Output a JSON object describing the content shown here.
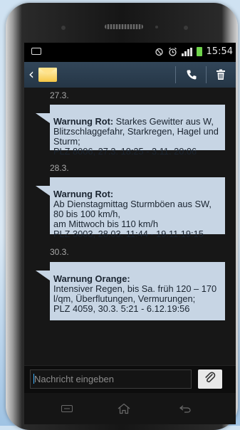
{
  "status_bar": {
    "time": "15:54",
    "icons": [
      "image-notification-icon",
      "nfc-icon",
      "alarm-icon",
      "signal-icon",
      "battery-icon"
    ]
  },
  "action_bar": {
    "back_icon": "chevron-left-icon",
    "app_icon": "envelope-icon",
    "call_icon": "phone-icon",
    "delete_icon": "trash-icon"
  },
  "messages": [
    {
      "date": "27.3.",
      "title": "Warnung Rot:",
      "body": " Starkes Gewitter aus W, Blitzschlaggefahr, Starkregen, Hagel und Sturm;\nPLZ 8006, 27.3. 18:25 - 3.11. 20:06"
    },
    {
      "date": "28.3.",
      "title": "Warnung Rot:",
      "body": "\nAb Dienstagmittag Sturmböen aus SW, 80 bis 100 km/h,\nam Mittwoch bis 110 km/h\nPLZ 3003, 28.03. 11:44 - 19.11.19:15"
    },
    {
      "date": "30.3.",
      "title": "Warnung Orange:",
      "body": "\nIntensiver Regen, bis Sa. früh 120 – 170 l/qm, Überflutungen, Vermurungen;\nPLZ 4059, 30.3. 5:21 - 6.12.19:56"
    }
  ],
  "composer": {
    "placeholder": "Nachricht eingeben",
    "attach_icon": "paperclip-icon"
  },
  "nav_bar": {
    "icons": [
      "menu-icon",
      "home-icon",
      "back-icon"
    ]
  },
  "colors": {
    "bubble": "#c7d5e4",
    "action_bar": "#2b3d4f",
    "battery": "#6fd44b"
  }
}
